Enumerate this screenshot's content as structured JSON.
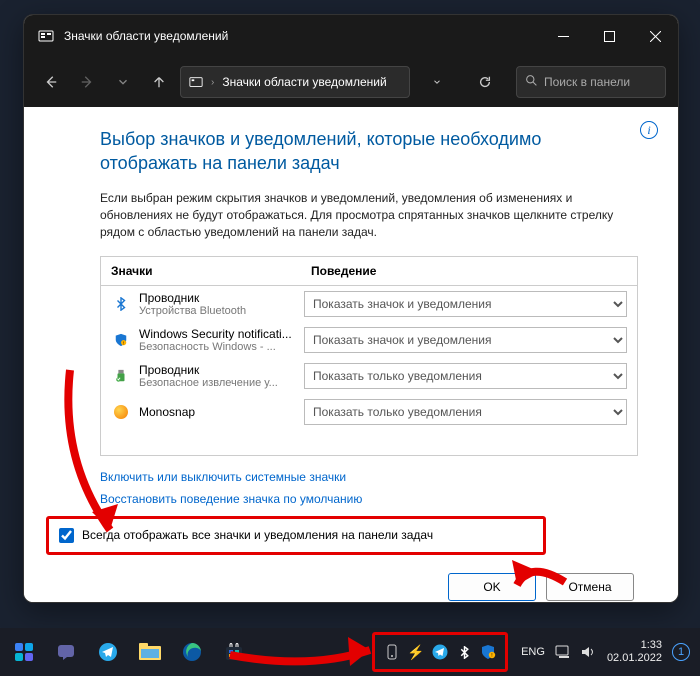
{
  "titlebar": {
    "title": "Значки области уведомлений"
  },
  "navbar": {
    "address": "Значки области уведомлений",
    "search_placeholder": "Поиск в панели"
  },
  "content": {
    "heading": "Выбор значков и уведомлений, которые необходимо отображать на панели задач",
    "desc": "Если выбран режим скрытия значков и уведомлений, уведомления об изменениях и обновлениях не будут отображаться. Для просмотра спрятанных значков щелкните стрелку рядом с областью уведомлений на панели задач.",
    "cols": {
      "c1": "Значки",
      "c2": "Поведение"
    },
    "rows": [
      {
        "title": "Проводник",
        "sub": "Устройства Bluetooth",
        "sel": "Показать значок и уведомления"
      },
      {
        "title": "Windows Security notificati...",
        "sub": "Безопасность Windows - ...",
        "sel": "Показать значок и уведомления"
      },
      {
        "title": "Проводник",
        "sub": "Безопасное извлечение у...",
        "sel": "Показать только уведомления"
      },
      {
        "title": "Monosnap",
        "sub": "",
        "sel": "Показать только уведомления"
      }
    ],
    "link1": "Включить или выключить системные значки",
    "link2": "Восстановить поведение значка по умолчанию",
    "check": "Всегда отображать все значки и уведомления на панели задач",
    "ok": "OK",
    "cancel": "Отмена"
  },
  "taskbar": {
    "lang": "ENG",
    "time": "1:33",
    "date": "02.01.2022"
  }
}
